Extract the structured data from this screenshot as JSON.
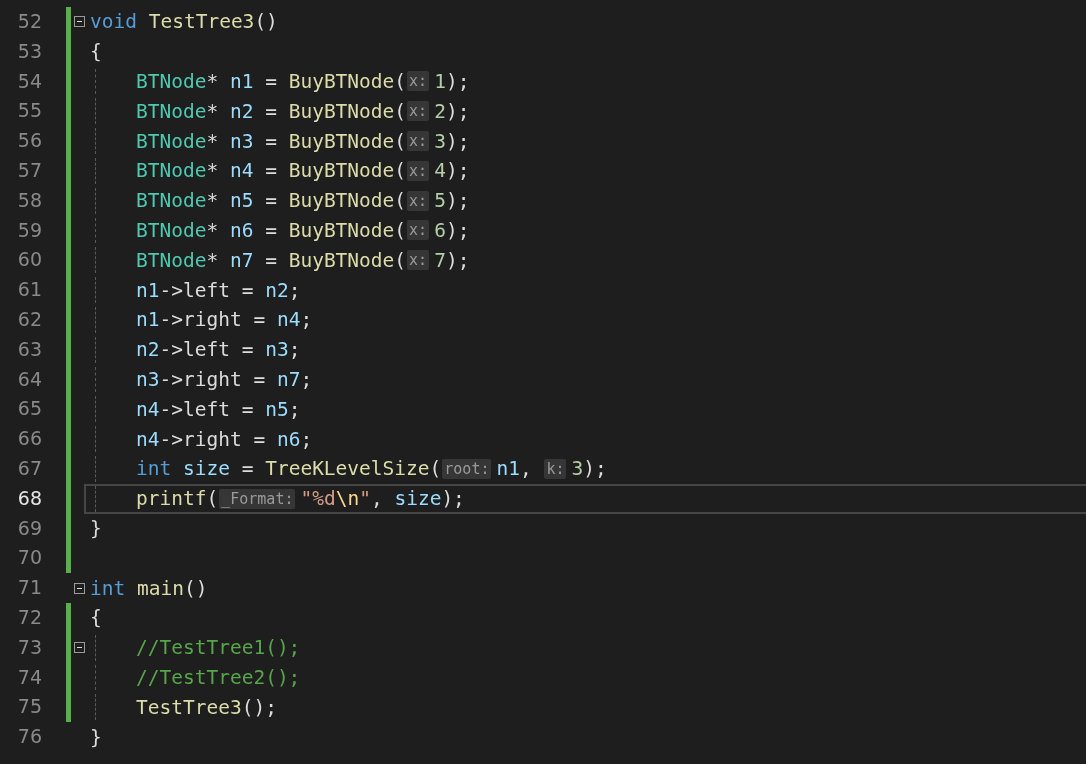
{
  "editor": {
    "lines": [
      {
        "number": "52",
        "current": false,
        "changed": true,
        "fold": true,
        "indented": false,
        "tokens": [
          {
            "kind": "keyword",
            "text": "void",
            "space": true
          },
          {
            "kind": "function",
            "text": "TestTree3"
          },
          {
            "kind": "plain",
            "text": "()"
          }
        ]
      },
      {
        "number": "53",
        "current": false,
        "changed": true,
        "fold": false,
        "indented": false,
        "tokens": [
          {
            "kind": "plain",
            "text": "{"
          }
        ]
      },
      {
        "number": "54",
        "current": false,
        "changed": true,
        "fold": false,
        "indented": true,
        "tokens": [
          {
            "kind": "type",
            "text": "BTNode"
          },
          {
            "kind": "plain",
            "text": "* "
          },
          {
            "kind": "variable",
            "text": "n1"
          },
          {
            "kind": "plain",
            "text": " = "
          },
          {
            "kind": "function",
            "text": "BuyBTNode"
          },
          {
            "kind": "plain",
            "text": "("
          },
          {
            "kind": "hint",
            "text": "x:"
          },
          {
            "kind": "number",
            "text": "1"
          },
          {
            "kind": "plain",
            "text": ");"
          }
        ]
      },
      {
        "number": "55",
        "current": false,
        "changed": true,
        "fold": false,
        "indented": true,
        "tokens": [
          {
            "kind": "type",
            "text": "BTNode"
          },
          {
            "kind": "plain",
            "text": "* "
          },
          {
            "kind": "variable",
            "text": "n2"
          },
          {
            "kind": "plain",
            "text": " = "
          },
          {
            "kind": "function",
            "text": "BuyBTNode"
          },
          {
            "kind": "plain",
            "text": "("
          },
          {
            "kind": "hint",
            "text": "x:"
          },
          {
            "kind": "number",
            "text": "2"
          },
          {
            "kind": "plain",
            "text": ");"
          }
        ]
      },
      {
        "number": "56",
        "current": false,
        "changed": true,
        "fold": false,
        "indented": true,
        "tokens": [
          {
            "kind": "type",
            "text": "BTNode"
          },
          {
            "kind": "plain",
            "text": "* "
          },
          {
            "kind": "variable",
            "text": "n3"
          },
          {
            "kind": "plain",
            "text": " = "
          },
          {
            "kind": "function",
            "text": "BuyBTNode"
          },
          {
            "kind": "plain",
            "text": "("
          },
          {
            "kind": "hint",
            "text": "x:"
          },
          {
            "kind": "number",
            "text": "3"
          },
          {
            "kind": "plain",
            "text": ");"
          }
        ]
      },
      {
        "number": "57",
        "current": false,
        "changed": true,
        "fold": false,
        "indented": true,
        "tokens": [
          {
            "kind": "type",
            "text": "BTNode"
          },
          {
            "kind": "plain",
            "text": "* "
          },
          {
            "kind": "variable",
            "text": "n4"
          },
          {
            "kind": "plain",
            "text": " = "
          },
          {
            "kind": "function",
            "text": "BuyBTNode"
          },
          {
            "kind": "plain",
            "text": "("
          },
          {
            "kind": "hint",
            "text": "x:"
          },
          {
            "kind": "number",
            "text": "4"
          },
          {
            "kind": "plain",
            "text": ");"
          }
        ]
      },
      {
        "number": "58",
        "current": false,
        "changed": true,
        "fold": false,
        "indented": true,
        "tokens": [
          {
            "kind": "type",
            "text": "BTNode"
          },
          {
            "kind": "plain",
            "text": "* "
          },
          {
            "kind": "variable",
            "text": "n5"
          },
          {
            "kind": "plain",
            "text": " = "
          },
          {
            "kind": "function",
            "text": "BuyBTNode"
          },
          {
            "kind": "plain",
            "text": "("
          },
          {
            "kind": "hint",
            "text": "x:"
          },
          {
            "kind": "number",
            "text": "5"
          },
          {
            "kind": "plain",
            "text": ");"
          }
        ]
      },
      {
        "number": "59",
        "current": false,
        "changed": true,
        "fold": false,
        "indented": true,
        "tokens": [
          {
            "kind": "type",
            "text": "BTNode"
          },
          {
            "kind": "plain",
            "text": "* "
          },
          {
            "kind": "variable",
            "text": "n6"
          },
          {
            "kind": "plain",
            "text": " = "
          },
          {
            "kind": "function",
            "text": "BuyBTNode"
          },
          {
            "kind": "plain",
            "text": "("
          },
          {
            "kind": "hint",
            "text": "x:"
          },
          {
            "kind": "number",
            "text": "6"
          },
          {
            "kind": "plain",
            "text": ");"
          }
        ]
      },
      {
        "number": "60",
        "current": false,
        "changed": true,
        "fold": false,
        "indented": true,
        "tokens": [
          {
            "kind": "type",
            "text": "BTNode"
          },
          {
            "kind": "plain",
            "text": "* "
          },
          {
            "kind": "variable",
            "text": "n7"
          },
          {
            "kind": "plain",
            "text": " = "
          },
          {
            "kind": "function",
            "text": "BuyBTNode"
          },
          {
            "kind": "plain",
            "text": "("
          },
          {
            "kind": "hint",
            "text": "x:"
          },
          {
            "kind": "number",
            "text": "7"
          },
          {
            "kind": "plain",
            "text": ");"
          }
        ]
      },
      {
        "number": "61",
        "current": false,
        "changed": true,
        "fold": false,
        "indented": true,
        "tokens": [
          {
            "kind": "variable",
            "text": "n1"
          },
          {
            "kind": "plain",
            "text": "->left = "
          },
          {
            "kind": "variable",
            "text": "n2"
          },
          {
            "kind": "plain",
            "text": ";"
          }
        ]
      },
      {
        "number": "62",
        "current": false,
        "changed": true,
        "fold": false,
        "indented": true,
        "tokens": [
          {
            "kind": "variable",
            "text": "n1"
          },
          {
            "kind": "plain",
            "text": "->right = "
          },
          {
            "kind": "variable",
            "text": "n4"
          },
          {
            "kind": "plain",
            "text": ";"
          }
        ]
      },
      {
        "number": "63",
        "current": false,
        "changed": true,
        "fold": false,
        "indented": true,
        "tokens": [
          {
            "kind": "variable",
            "text": "n2"
          },
          {
            "kind": "plain",
            "text": "->left = "
          },
          {
            "kind": "variable",
            "text": "n3"
          },
          {
            "kind": "plain",
            "text": ";"
          }
        ]
      },
      {
        "number": "64",
        "current": false,
        "changed": true,
        "fold": false,
        "indented": true,
        "tokens": [
          {
            "kind": "variable",
            "text": "n3"
          },
          {
            "kind": "plain",
            "text": "->right = "
          },
          {
            "kind": "variable",
            "text": "n7"
          },
          {
            "kind": "plain",
            "text": ";"
          }
        ]
      },
      {
        "number": "65",
        "current": false,
        "changed": true,
        "fold": false,
        "indented": true,
        "tokens": [
          {
            "kind": "variable",
            "text": "n4"
          },
          {
            "kind": "plain",
            "text": "->left = "
          },
          {
            "kind": "variable",
            "text": "n5"
          },
          {
            "kind": "plain",
            "text": ";"
          }
        ]
      },
      {
        "number": "66",
        "current": false,
        "changed": true,
        "fold": false,
        "indented": true,
        "tokens": [
          {
            "kind": "variable",
            "text": "n4"
          },
          {
            "kind": "plain",
            "text": "->right = "
          },
          {
            "kind": "variable",
            "text": "n6"
          },
          {
            "kind": "plain",
            "text": ";"
          }
        ]
      },
      {
        "number": "67",
        "current": false,
        "changed": true,
        "fold": false,
        "indented": true,
        "tokens": [
          {
            "kind": "keyword",
            "text": "int",
            "space": true
          },
          {
            "kind": "variable",
            "text": "size"
          },
          {
            "kind": "plain",
            "text": " = "
          },
          {
            "kind": "function",
            "text": "TreeKLevelSize"
          },
          {
            "kind": "plain",
            "text": "("
          },
          {
            "kind": "hint",
            "text": "root:"
          },
          {
            "kind": "variable",
            "text": "n1"
          },
          {
            "kind": "plain",
            "text": ", "
          },
          {
            "kind": "hint",
            "text": "k:"
          },
          {
            "kind": "number",
            "text": "3"
          },
          {
            "kind": "plain",
            "text": ");"
          }
        ]
      },
      {
        "number": "68",
        "current": true,
        "changed": true,
        "fold": false,
        "indented": true,
        "tokens": [
          {
            "kind": "function",
            "text": "printf"
          },
          {
            "kind": "plain",
            "text": "("
          },
          {
            "kind": "hint",
            "text": "_Format:"
          },
          {
            "kind": "string",
            "text": "\"%d"
          },
          {
            "kind": "escape",
            "text": "\\n"
          },
          {
            "kind": "string",
            "text": "\""
          },
          {
            "kind": "plain",
            "text": ", "
          },
          {
            "kind": "variable",
            "text": "size"
          },
          {
            "kind": "plain",
            "text": ");"
          }
        ]
      },
      {
        "number": "69",
        "current": false,
        "changed": true,
        "fold": false,
        "indented": false,
        "tokens": [
          {
            "kind": "plain",
            "text": "}"
          }
        ]
      },
      {
        "number": "70",
        "current": false,
        "changed": true,
        "fold": false,
        "indented": false
      },
      {
        "number": "71",
        "current": false,
        "changed": false,
        "fold": true,
        "indented": false,
        "tokens": [
          {
            "kind": "keyword",
            "text": "int",
            "space": true
          },
          {
            "kind": "function",
            "text": "main"
          },
          {
            "kind": "plain",
            "text": "()"
          }
        ]
      },
      {
        "number": "72",
        "current": false,
        "changed": true,
        "fold": false,
        "indented": false,
        "tokens": [
          {
            "kind": "plain",
            "text": "{"
          }
        ]
      },
      {
        "number": "73",
        "current": false,
        "changed": true,
        "fold": true,
        "indented": true,
        "tokens": [
          {
            "kind": "comment",
            "text": "//TestTree1();"
          }
        ]
      },
      {
        "number": "74",
        "current": false,
        "changed": true,
        "fold": false,
        "indented": true,
        "tokens": [
          {
            "kind": "comment",
            "text": "//TestTree2();"
          }
        ]
      },
      {
        "number": "75",
        "current": false,
        "changed": true,
        "fold": false,
        "indented": true,
        "tokens": [
          {
            "kind": "function",
            "text": "TestTree3"
          },
          {
            "kind": "plain",
            "text": "();"
          }
        ]
      },
      {
        "number": "76",
        "current": false,
        "changed": false,
        "fold": false,
        "indented": false,
        "tokens": [
          {
            "kind": "plain",
            "text": "}"
          }
        ]
      }
    ]
  }
}
